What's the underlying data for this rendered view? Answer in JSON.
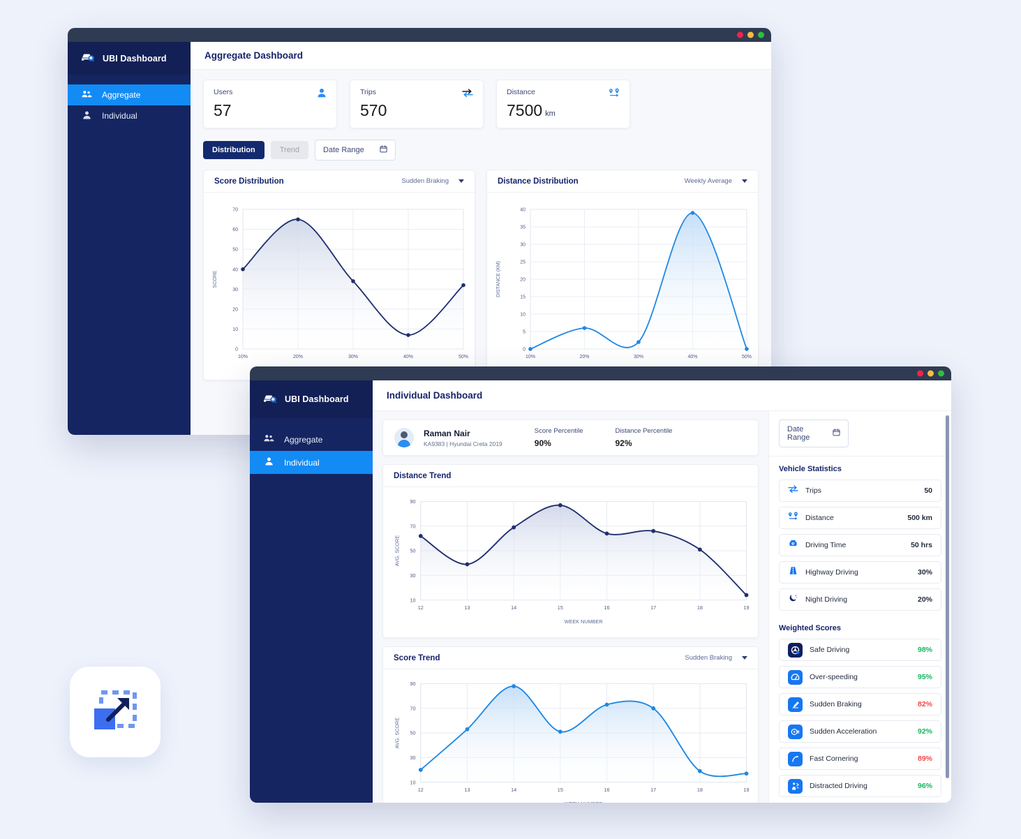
{
  "window1": {
    "brand": "UBI Dashboard",
    "page_title": "Aggregate Dashboard",
    "nav": [
      {
        "label": "Aggregate",
        "icon": "group-icon",
        "active": true
      },
      {
        "label": "Individual",
        "icon": "person-icon",
        "active": false
      }
    ],
    "stats": [
      {
        "label": "Users",
        "value": "57",
        "unit": "",
        "icon": "person-icon"
      },
      {
        "label": "Trips",
        "value": "570",
        "unit": "",
        "icon": "swap-arrows-icon"
      },
      {
        "label": "Distance",
        "value": "7500",
        "unit": "km",
        "icon": "map-pins-icon"
      }
    ],
    "toggle": {
      "distribution": "Distribution",
      "trend": "Trend",
      "date_range": "Date Range"
    },
    "charts": {
      "score": {
        "title": "Score Distribution",
        "select": "Sudden Braking"
      },
      "distance": {
        "title": "Distance Distribution",
        "select": "Weekly Average"
      }
    }
  },
  "window2": {
    "brand": "UBI Dashboard",
    "page_title": "Individual Dashboard",
    "nav": [
      {
        "label": "Aggregate",
        "icon": "group-icon",
        "active": false
      },
      {
        "label": "Individual",
        "icon": "person-icon",
        "active": true
      }
    ],
    "profile": {
      "name": "Raman Nair",
      "meta": "KA9383  |  Hyundai Creta 2019",
      "score_percentile_label": "Score Percentile",
      "score_percentile_value": "90%",
      "distance_percentile_label": "Distance Percentile",
      "distance_percentile_value": "92%"
    },
    "date_range": "Date Range",
    "charts": {
      "distance_trend": {
        "title": "Distance Trend"
      },
      "score_trend": {
        "title": "Score Trend",
        "select": "Sudden Braking"
      }
    },
    "vehicle_statistics": {
      "title": "Vehicle Statistics",
      "rows": [
        {
          "label": "Trips",
          "value": "50",
          "icon": "swap-arrows-icon"
        },
        {
          "label": "Distance",
          "value": "500 km",
          "icon": "map-pins-icon"
        },
        {
          "label": "Driving Time",
          "value": "50 hrs",
          "icon": "car-clock-icon"
        },
        {
          "label": "Highway Driving",
          "value": "30%",
          "icon": "highway-icon"
        },
        {
          "label": "Night Driving",
          "value": "20%",
          "icon": "moon-icon"
        }
      ]
    },
    "weighted_scores": {
      "title": "Weighted Scores",
      "rows": [
        {
          "label": "Safe Driving",
          "value": "98%",
          "state": "good",
          "icon": "steering-wheel-icon"
        },
        {
          "label": "Over-speeding",
          "value": "95%",
          "state": "good",
          "icon": "speedometer-icon"
        },
        {
          "label": "Sudden Braking",
          "value": "82%",
          "state": "bad",
          "icon": "brake-pedal-icon"
        },
        {
          "label": "Sudden Acceleration",
          "value": "92%",
          "state": "good",
          "icon": "accelerate-icon"
        },
        {
          "label": "Fast Cornering",
          "value": "89%",
          "state": "bad",
          "icon": "cornering-icon"
        },
        {
          "label": "Distracted Driving",
          "value": "96%",
          "state": "good",
          "icon": "distracted-driver-icon"
        }
      ]
    }
  },
  "colors": {
    "brand_navy": "#152562",
    "accent_blue": "#128bf5",
    "good_green": "#17b55f",
    "bad_red": "#f24747",
    "page_bg": "#eef2fb"
  },
  "app_icon": {
    "name": "scale-expand-icon"
  },
  "chart_data": [
    {
      "id": "score-distribution",
      "type": "area",
      "title": "Score Distribution",
      "series_label": "Sudden Braking",
      "xlabel": "",
      "ylabel": "SCORE",
      "categories": [
        "10%",
        "20%",
        "30%",
        "40%",
        "50%"
      ],
      "x": [
        10,
        20,
        30,
        40,
        50
      ],
      "values": [
        40,
        65,
        34,
        7,
        32
      ],
      "ylim": [
        0,
        70
      ],
      "yticks": [
        0,
        10,
        20,
        30,
        40,
        50,
        60,
        70
      ],
      "grid": true,
      "line_color": "#1f2f6e",
      "legend": "none"
    },
    {
      "id": "distance-distribution",
      "type": "area",
      "title": "Distance Distribution",
      "series_label": "Weekly Average",
      "xlabel": "",
      "ylabel": "DISTANCE (KM)",
      "categories": [
        "10%",
        "20%",
        "30%",
        "40%",
        "50%"
      ],
      "x": [
        10,
        20,
        30,
        40,
        50
      ],
      "values": [
        0,
        6,
        2,
        39,
        0
      ],
      "ylim": [
        0,
        40
      ],
      "yticks": [
        0,
        5,
        10,
        15,
        20,
        25,
        30,
        35,
        40
      ],
      "grid": true,
      "line_color": "#1e88e5",
      "legend": "none"
    },
    {
      "id": "distance-trend",
      "type": "area",
      "title": "Distance Trend",
      "xlabel": "WEEK NUMBER",
      "ylabel": "AVG. SCORE",
      "categories": [
        "12",
        "13",
        "14",
        "15",
        "16",
        "17",
        "18",
        "19"
      ],
      "x": [
        12,
        13,
        14,
        15,
        16,
        17,
        18,
        19
      ],
      "values": [
        62,
        39,
        69,
        87,
        64,
        66,
        51,
        14
      ],
      "ylim": [
        10,
        90
      ],
      "yticks": [
        10,
        30,
        50,
        70,
        90
      ],
      "grid": true,
      "line_color": "#1f2f6e",
      "legend": "none"
    },
    {
      "id": "score-trend",
      "type": "area",
      "title": "Score Trend",
      "series_label": "Sudden Braking",
      "xlabel": "WEEK NUMBER",
      "ylabel": "AVG. SCORE",
      "categories": [
        "12",
        "13",
        "14",
        "15",
        "16",
        "17",
        "18",
        "19"
      ],
      "x": [
        12,
        13,
        14,
        15,
        16,
        17,
        18,
        19
      ],
      "values": [
        20,
        53,
        88,
        51,
        73,
        70,
        19,
        17
      ],
      "ylim": [
        10,
        90
      ],
      "yticks": [
        10,
        30,
        50,
        70,
        90
      ],
      "grid": true,
      "line_color": "#1e88e5",
      "legend": "none"
    }
  ]
}
